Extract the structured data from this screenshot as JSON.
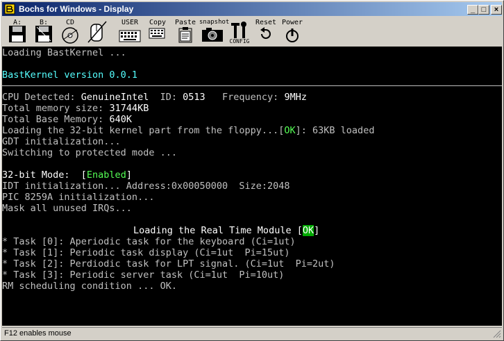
{
  "window": {
    "title": "Bochs for Windows - Display"
  },
  "title_buttons": {
    "minimize": "_",
    "maximize": "□",
    "close": "×"
  },
  "toolbar": {
    "floppy_a": "A:",
    "floppy_b": "B:",
    "cdrom": "CD",
    "user": "USER",
    "copy": "Copy",
    "paste": "Paste",
    "snapshot": "snapshot",
    "config": "CONFIG",
    "reset": "Reset",
    "power": "Power"
  },
  "screen": {
    "line1": "Loading BastKernel ...",
    "version": "BastKernel version 0.0.1",
    "cpu_prefix": "CPU Detected: ",
    "cpu_vendor": "GenuineIntel",
    "cpu_id_label": "  ID: ",
    "cpu_id": "0513",
    "cpu_freq_label": "   Frequency: ",
    "cpu_freq": "9MHz",
    "mem_total_label": "Total memory size: ",
    "mem_total": "31744KB",
    "mem_base_label": "Total Base Memory: ",
    "mem_base": "640K",
    "load_prefix": "Loading the 32-bit kernel part from the floppy...[",
    "ok": "OK",
    "load_suffix": "]: 63KB loaded",
    "gdt": "GDT initialization...",
    "protected": "Switching to protected mode ...",
    "mode_prefix": "32-bit Mode:  [",
    "mode_enabled": "Enabled",
    "mode_suffix": "]",
    "idt": "IDT initialization... Address:0x00050000  Size:2048",
    "pic": "PIC 8259A initialization...",
    "mask": "Mask all unused IRQs...",
    "rt_prefix": "Loading the Real Time Module [",
    "rt_ok": "OK",
    "rt_suffix": "]",
    "task0": "* Task [0]: Aperiodic task for the keyboard (Ci=1ut)",
    "task1": "* Task [1]: Periodic task display (Ci=1ut  Pi=15ut)",
    "task2": "* Task [2]: Perdiodic task for LPT signal. (Ci=1ut  Pi=2ut)",
    "task3": "* Task [3]: Periodic server task (Ci=1ut  Pi=10ut)",
    "rm": "RM scheduling condition ... OK."
  },
  "status": {
    "text": "F12 enables mouse"
  },
  "icons": {
    "app": "bochs-app-icon",
    "floppy": "floppy-disk-icon",
    "cdrom": "cdrom-icon",
    "mouse": "mouse-icon",
    "keyboard": "keyboard-icon",
    "clipboard": "clipboard-icon",
    "camera": "camera-icon",
    "config": "config-tools-icon",
    "reset": "reset-arrow-icon",
    "power": "power-icon"
  }
}
